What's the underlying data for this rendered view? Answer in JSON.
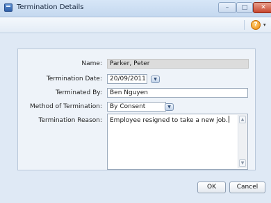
{
  "window": {
    "title": "Termination Details",
    "controls": {
      "minimize": "–",
      "maximize": "□",
      "close": "✕"
    }
  },
  "toolbar": {
    "help_icon_glyph": "?",
    "help_dropdown_glyph": "▾"
  },
  "form": {
    "name": {
      "label": "Name:",
      "value": "Parker, Peter"
    },
    "termination_date": {
      "label": "Termination Date:",
      "value": "20/09/2011"
    },
    "terminated_by": {
      "label": "Terminated By:",
      "value": "Ben Nguyen"
    },
    "method": {
      "label": "Method of Termination:",
      "value": "By Consent"
    },
    "reason": {
      "label": "Termination Reason:",
      "value": "Employee resigned to take a new job."
    }
  },
  "buttons": {
    "ok": "OK",
    "cancel": "Cancel"
  },
  "glyphs": {
    "dropdown": "▼",
    "scroll_up": "▲",
    "scroll_down": "▼"
  },
  "colors": {
    "accent": "#2f5fa8",
    "close_button": "#c8472f",
    "help_icon": "#f08a0a"
  }
}
